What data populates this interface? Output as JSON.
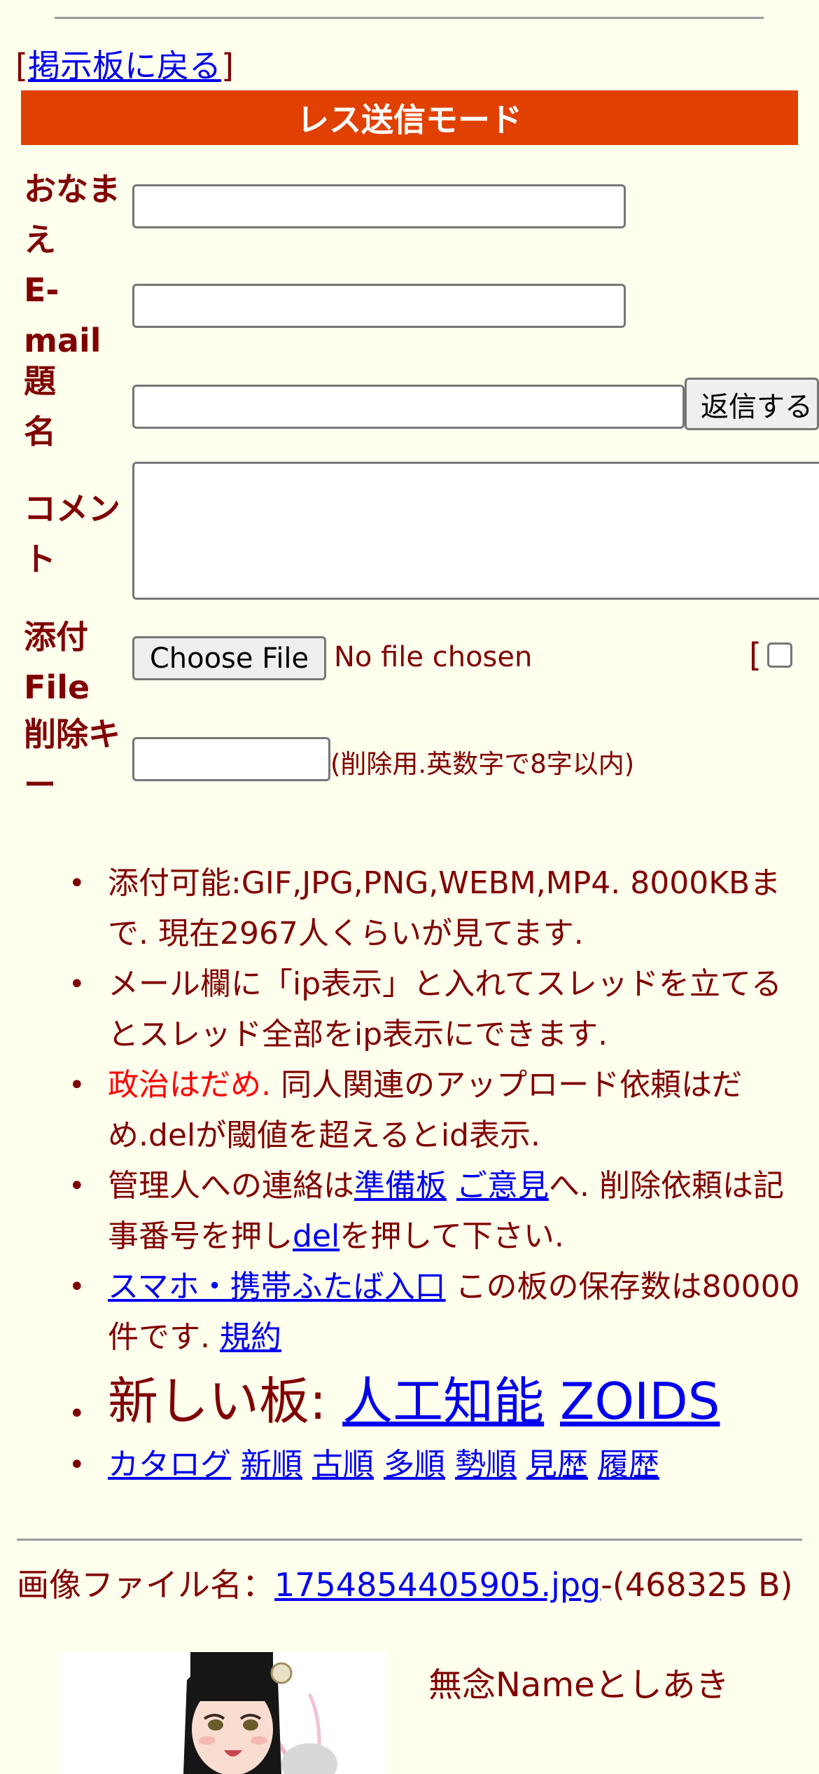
{
  "nav": {
    "bracket_open": "[",
    "back_link": "掲示板に戻る",
    "bracket_close": "]"
  },
  "form": {
    "mode_title": "レス送信モード",
    "name_label": "おなまえ",
    "email_label": "E-mail",
    "subject_label": "題名",
    "submit_button": "返信する",
    "comment_label": "コメント",
    "file_label": "添付File",
    "choose_file_button": "Choose File",
    "no_file_text": "No file chosen",
    "image_toggle_bracket": "[",
    "delkey_label": "削除キー",
    "delkey_note": "(削除用.英数字で8字以内)"
  },
  "rules": {
    "item1": "添付可能:GIF,JPG,PNG,WEBM,MP4. 8000KBまで. 現在2967人くらいが見てます.",
    "item2": "メール欄に「ip表示」と入れてスレッドを立てるとスレッド全部をip表示にできます.",
    "item3_red": "政治はだめ.",
    "item3_rest": " 同人関連のアップロード依頼はだめ.delが閾値を超えるとid表示.",
    "item4_a": "管理人への連絡は",
    "item4_link1": "準備板",
    "item4_link2": "ご意見",
    "item4_b": "へ. 削除依頼は記事番号を押し",
    "item4_link3": "del",
    "item4_c": "を押して下さい.",
    "item5_link": "スマホ・携帯ふたば入口",
    "item5_a": " この板の保存数は80000件です. ",
    "item5_link2": "規約",
    "item6_label": "新しい板: ",
    "item6_link1": "人工知能",
    "item6_link2": "ZOIDS",
    "sort_links": [
      "カタログ",
      "新順",
      "古順",
      "多順",
      "勢順",
      "見歴",
      "履歴"
    ]
  },
  "post": {
    "file_label": "画像ファイル名：",
    "file_link": "1754854405905.jpg",
    "file_size": "-(468325 B)",
    "poster_name": "無念Nameとしあき"
  },
  "colors": {
    "background": "#FFFFEE",
    "text": "#800000",
    "header_bar": "#E04000",
    "link": "#0000EE",
    "warning": "#FF0000"
  }
}
